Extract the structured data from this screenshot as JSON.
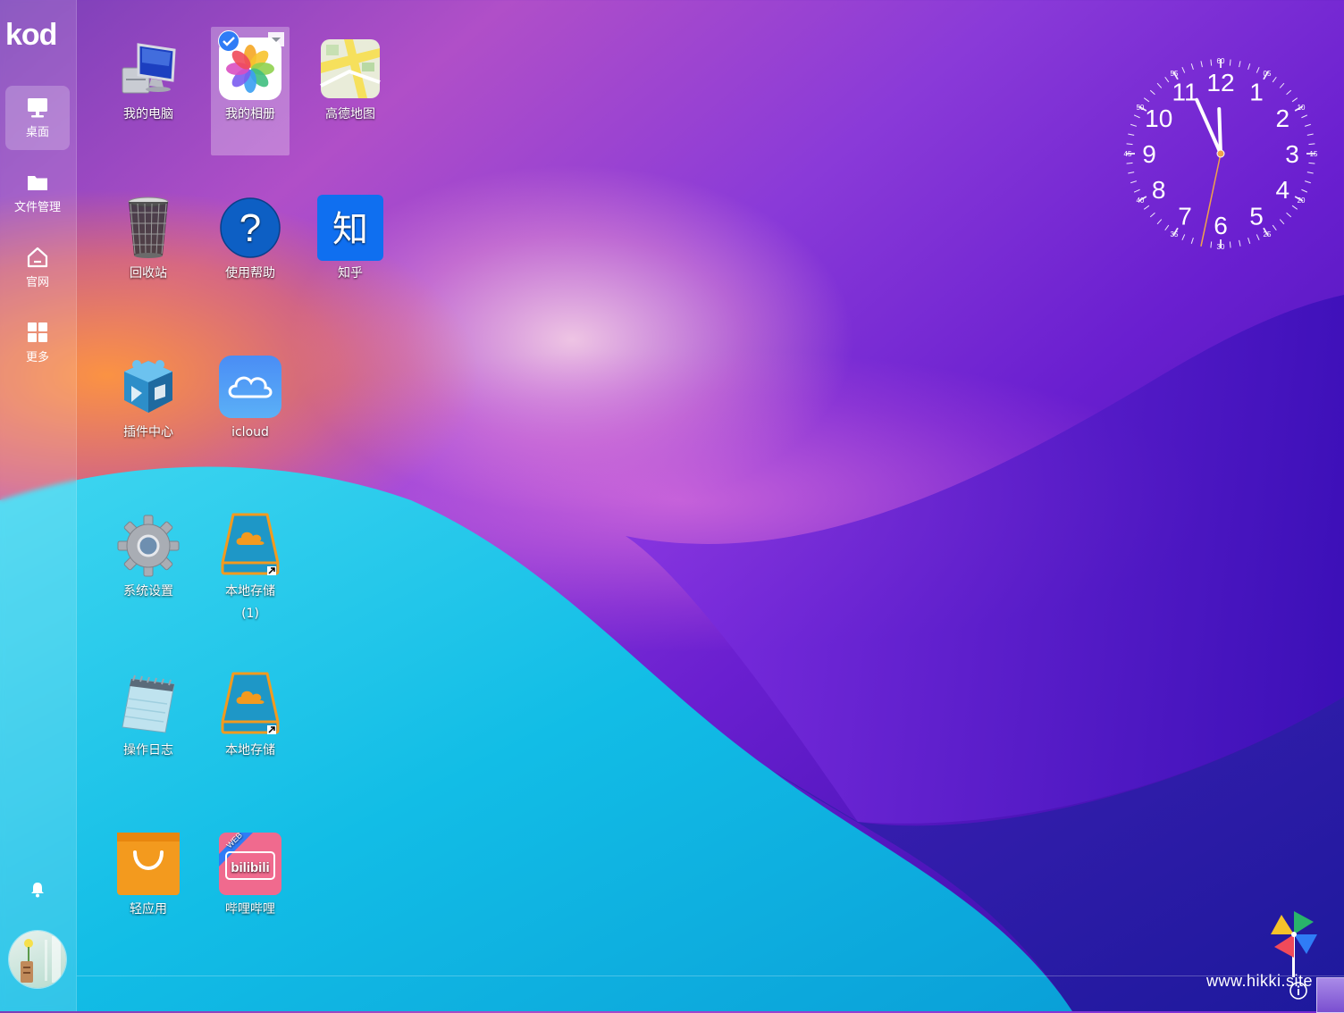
{
  "app": {
    "logo": "kod"
  },
  "sidebar": {
    "items": [
      {
        "label": "桌面",
        "icon": "desktop-icon",
        "active": true
      },
      {
        "label": "文件管理",
        "icon": "folder-icon",
        "active": false
      },
      {
        "label": "官网",
        "icon": "home-icon",
        "active": false
      },
      {
        "label": "更多",
        "icon": "grid-icon",
        "active": false
      }
    ],
    "bell_icon": "bell-icon",
    "avatar_icon": "avatar-icon"
  },
  "desktop": {
    "icons": [
      {
        "label": "我的电脑",
        "icon": "computer-icon"
      },
      {
        "label": "我的相册",
        "icon": "photos-icon",
        "selected": true
      },
      {
        "label": "高德地图",
        "icon": "map-icon"
      },
      {
        "label": "回收站",
        "icon": "recycle-bin-icon"
      },
      {
        "label": "使用帮助",
        "icon": "help-icon"
      },
      {
        "label": "知乎",
        "icon": "zhihu-icon",
        "glyph": "知"
      },
      {
        "label": "插件中心",
        "icon": "plugin-icon"
      },
      {
        "label": "icloud",
        "icon": "cloud-icon"
      },
      {
        "label": "系统设置",
        "icon": "settings-gear-icon"
      },
      {
        "label": "本地存储\n(1)",
        "icon": "storage-icon"
      },
      {
        "label": "操作日志",
        "icon": "notepad-icon"
      },
      {
        "label": "本地存储",
        "icon": "storage-icon"
      },
      {
        "label": "轻应用",
        "icon": "shopping-bag-icon"
      },
      {
        "label": "哔哩哔哩",
        "icon": "bilibili-icon",
        "badge": "WEB",
        "glyph": "bilibili"
      }
    ]
  },
  "clock": {
    "hour_numbers": [
      "12",
      "1",
      "2",
      "3",
      "4",
      "5",
      "6",
      "7",
      "8",
      "9",
      "10",
      "11"
    ],
    "minute_labels": [
      "60",
      "05",
      "10",
      "15",
      "20",
      "25",
      "30",
      "35",
      "40",
      "45",
      "50",
      "55"
    ],
    "time": {
      "hour": 11,
      "minute": 56,
      "second": 32
    }
  },
  "footer": {
    "watermark": "www.hikki.site",
    "info_icon": "info-icon",
    "pinwheel_icon": "pinwheel-icon"
  },
  "colors": {
    "accent_blue": "#2f7cf6",
    "zhihu_blue": "#0f6ff0",
    "bilibili_pink": "#f06a8e",
    "storage_orange": "#f39a1e"
  }
}
